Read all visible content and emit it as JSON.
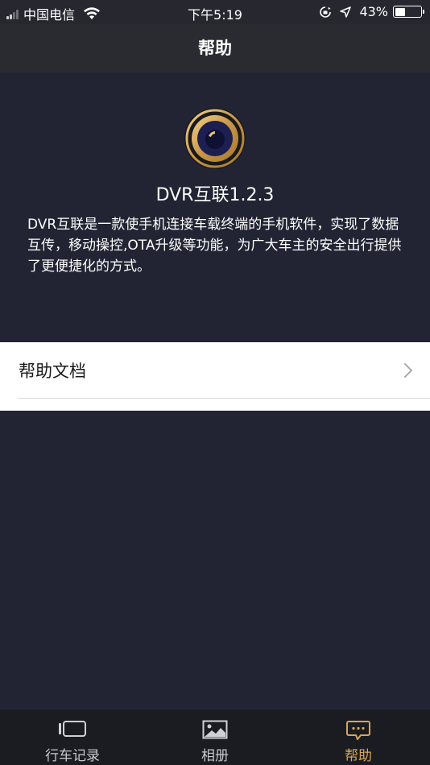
{
  "status_bar": {
    "carrier": "中国电信",
    "time": "下午5:19",
    "battery_percent": "43%",
    "battery_level": 0.43
  },
  "nav": {
    "title": "帮助"
  },
  "about": {
    "app_name": "DVR互联1.2.3",
    "description": "DVR互联是一款使手机连接车载终端的手机软件，实现了数据互传，移动操控,OTA升级等功能，为广大车主的安全出行提供了更便捷化的方式。",
    "logo_icon": "camera-eye-icon"
  },
  "help_list": {
    "items": [
      {
        "label": "帮助文档",
        "icon": "chevron-right-icon"
      }
    ]
  },
  "tabs": [
    {
      "label": "行车记录",
      "icon": "driving-record-icon",
      "active": false
    },
    {
      "label": "相册",
      "icon": "album-icon",
      "active": false
    },
    {
      "label": "帮助",
      "icon": "chat-help-icon",
      "active": true
    }
  ],
  "colors": {
    "background": "#222433",
    "nav_bar": "#2a2b31",
    "tab_bar": "#1b1c21",
    "accent_gold": "#d6a75b",
    "logo_navy": "#1c1f4f"
  }
}
